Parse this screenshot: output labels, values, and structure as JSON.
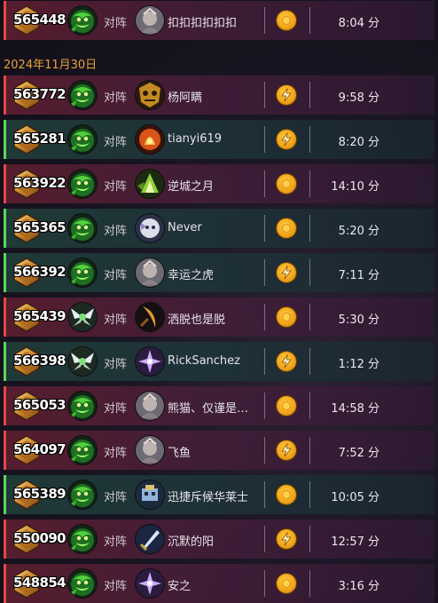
{
  "date_header": "2024年11月30日",
  "vs_label": "对阵",
  "duration_unit": "分",
  "colors": {
    "loss_accent": "#e04848",
    "win_accent": "#58d858",
    "date_color": "#e9a23a",
    "mode_gold": "#f1a51a"
  },
  "rows": [
    {
      "result": "loss",
      "mmr": "565448",
      "hero": "green-monster",
      "opponent": "扣扣扣扣扣扣",
      "opponent_icon": "grey-warrior",
      "mode": "coin",
      "duration": "8:04 分"
    },
    {
      "result": "loss",
      "mmr": "563772",
      "hero": "green-monster",
      "opponent": "杨阿瞒",
      "opponent_icon": "gold-mask",
      "mode": "lightning",
      "duration": "9:58 分"
    },
    {
      "result": "win",
      "mmr": "565281",
      "hero": "green-monster",
      "opponent": "tianyi619",
      "opponent_icon": "fire-mage",
      "mode": "lightning",
      "duration": "8:20 分"
    },
    {
      "result": "loss",
      "mmr": "563922",
      "hero": "green-monster",
      "opponent": "逆城之月",
      "opponent_icon": "green-crystal",
      "mode": "coin",
      "duration": "14:10 分"
    },
    {
      "result": "win",
      "mmr": "565365",
      "hero": "green-monster",
      "opponent": "Never",
      "opponent_icon": "white-beast",
      "mode": "coin",
      "duration": "5:20 分"
    },
    {
      "result": "win",
      "mmr": "566392",
      "hero": "green-monster",
      "opponent": "幸运之虎",
      "opponent_icon": "grey-warrior",
      "mode": "lightning",
      "duration": "7:11 分"
    },
    {
      "result": "loss",
      "mmr": "565439",
      "hero": "white-wings",
      "opponent": "洒脱也是脱",
      "opponent_icon": "dark-blade",
      "mode": "coin",
      "duration": "5:30 分"
    },
    {
      "result": "win",
      "mmr": "566398",
      "hero": "white-wings",
      "opponent": "RickSanchez",
      "opponent_icon": "purple-star",
      "mode": "lightning",
      "duration": "1:12 分"
    },
    {
      "result": "loss",
      "mmr": "565053",
      "hero": "green-monster",
      "opponent": "熊猫、仅谨是…",
      "opponent_icon": "grey-warrior",
      "mode": "coin",
      "duration": "14:58 分"
    },
    {
      "result": "loss",
      "mmr": "564097",
      "hero": "green-monster",
      "opponent": "飞鱼",
      "opponent_icon": "grey-warrior",
      "mode": "lightning",
      "duration": "7:52 分"
    },
    {
      "result": "win",
      "mmr": "565389",
      "hero": "green-monster",
      "opponent": "迅捷斥候华莱士",
      "opponent_icon": "blue-mech",
      "mode": "coin",
      "duration": "10:05 分"
    },
    {
      "result": "loss",
      "mmr": "550090",
      "hero": "green-monster",
      "opponent": "沉默的阳",
      "opponent_icon": "blue-sword",
      "mode": "lightning",
      "duration": "12:57 分"
    },
    {
      "result": "loss",
      "mmr": "548854",
      "hero": "green-monster",
      "opponent": "安之",
      "opponent_icon": "purple-star",
      "mode": "coin",
      "duration": "3:16 分"
    }
  ]
}
